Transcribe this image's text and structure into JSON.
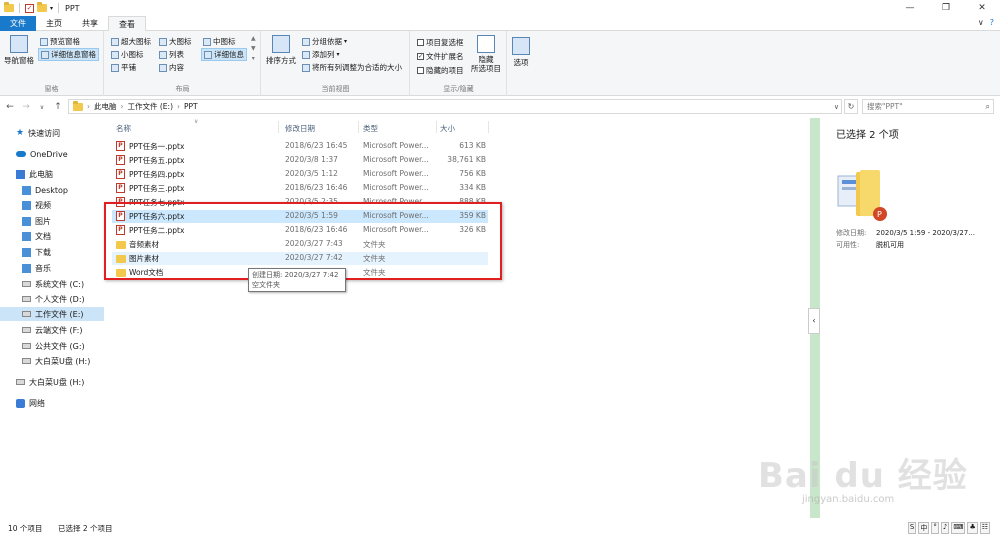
{
  "window": {
    "title": "PPT",
    "controls": [
      "—",
      "❐",
      "✕"
    ]
  },
  "ribbon_tabs": [
    "文件",
    "主页",
    "共享",
    "查看"
  ],
  "ribbon": {
    "panes": {
      "nav_pane": "导航窗格",
      "preview": "预览窗格",
      "details": "详细信息窗格",
      "label": "窗格"
    },
    "layout": {
      "items": [
        "超大图标",
        "大图标",
        "中图标",
        "小图标",
        "列表",
        "详细信息",
        "平铺",
        "内容"
      ],
      "label": "布局"
    },
    "current_view": {
      "sort": "排序方式",
      "group_by": "分组依据",
      "add_column": "添加列",
      "fit_columns": "将所有列调整为合适的大小",
      "label": "当前视图"
    },
    "show_hide": {
      "item_checkbox": "项目复选框",
      "file_ext": "文件扩展名",
      "hidden_items": "隐藏的项目",
      "hide_selected": [
        "隐藏",
        "所选项目"
      ],
      "label": "显示/隐藏"
    },
    "options": "选项"
  },
  "address": {
    "crumbs": [
      "此电脑",
      "工作文件 (E:)",
      "PPT"
    ],
    "search_placeholder": "搜索\"PPT\""
  },
  "nav_pane": [
    {
      "label": "快速访问",
      "icon": "star-icon"
    },
    {
      "label": "OneDrive",
      "icon": "cloud-icon"
    },
    {
      "label": "此电脑",
      "icon": "pc-icon"
    },
    {
      "label": "Desktop",
      "icon": "folder-icon"
    },
    {
      "label": "视频",
      "icon": "folder-icon"
    },
    {
      "label": "图片",
      "icon": "folder-icon"
    },
    {
      "label": "文档",
      "icon": "folder-icon"
    },
    {
      "label": "下载",
      "icon": "folder-icon"
    },
    {
      "label": "音乐",
      "icon": "folder-icon"
    },
    {
      "label": "系统文件 (C:)",
      "icon": "drive-icon"
    },
    {
      "label": "个人文件 (D:)",
      "icon": "drive-icon"
    },
    {
      "label": "工作文件 (E:)",
      "icon": "drive-icon"
    },
    {
      "label": "云端文件 (F:)",
      "icon": "drive-icon"
    },
    {
      "label": "公共文件 (G:)",
      "icon": "drive-icon"
    },
    {
      "label": "大白菜U盘 (H:)",
      "icon": "drive-icon"
    },
    {
      "label": "大白菜U盘 (H:)",
      "icon": "drive-icon"
    },
    {
      "label": "网络",
      "icon": "network-icon"
    }
  ],
  "columns": [
    "名称",
    "修改日期",
    "类型",
    "大小"
  ],
  "files": [
    {
      "name": "PPT任务一.pptx",
      "date": "2018/6/23 16:45",
      "type": "Microsoft Power...",
      "size": "613 KB",
      "kind": "ppt"
    },
    {
      "name": "PPT任务五.pptx",
      "date": "2020/3/8 1:37",
      "type": "Microsoft Power...",
      "size": "38,761 KB",
      "kind": "ppt"
    },
    {
      "name": "PPT任务四.pptx",
      "date": "2020/3/5 1:12",
      "type": "Microsoft Power...",
      "size": "756 KB",
      "kind": "ppt"
    },
    {
      "name": "PPT任务三.pptx",
      "date": "2018/6/23 16:46",
      "type": "Microsoft Power...",
      "size": "334 KB",
      "kind": "ppt"
    },
    {
      "name": "PPT任务七.pptx",
      "date": "2020/3/5 2:35",
      "type": "Microsoft Power...",
      "size": "888 KB",
      "kind": "ppt"
    },
    {
      "name": "PPT任务六.pptx",
      "date": "2020/3/5 1:59",
      "type": "Microsoft Power...",
      "size": "359 KB",
      "kind": "ppt",
      "state": "sel"
    },
    {
      "name": "PPT任务二.pptx",
      "date": "2018/6/23 16:46",
      "type": "Microsoft Power...",
      "size": "326 KB",
      "kind": "ppt"
    },
    {
      "name": "音频素材",
      "date": "2020/3/27 7:43",
      "type": "文件夹",
      "size": "",
      "kind": "folder"
    },
    {
      "name": "图片素材",
      "date": "2020/3/27 7:42",
      "type": "文件夹",
      "size": "",
      "kind": "folder",
      "state": "sel"
    },
    {
      "name": "Word文档",
      "date": "",
      "type": "文件夹",
      "size": "",
      "kind": "folder"
    }
  ],
  "tooltip": {
    "created": "创建日期: 2020/3/27 7:42",
    "desc": "空文件夹"
  },
  "details": {
    "title": "已选择 2 个项",
    "modified_label": "修改日期:",
    "modified_value": "2020/3/5 1:59 - 2020/3/27...",
    "avail_label": "可用性:",
    "avail_value": "脱机可用"
  },
  "status": {
    "count": "10 个项目",
    "selected": "已选择 2 个项目"
  },
  "watermark": {
    "main": "Bai du 经验",
    "sub": "jingyan.baidu.com"
  }
}
